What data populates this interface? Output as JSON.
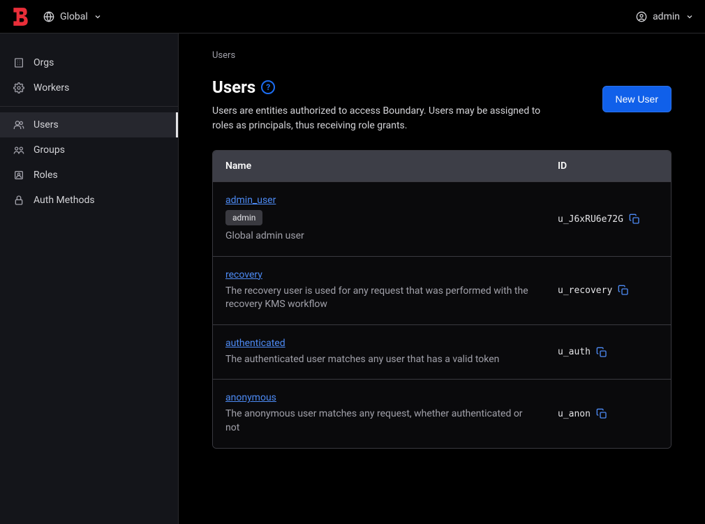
{
  "header": {
    "scope_label": "Global",
    "user_label": "admin"
  },
  "sidebar": {
    "group1": [
      {
        "label": "Orgs"
      },
      {
        "label": "Workers"
      }
    ],
    "group2": [
      {
        "label": "Users"
      },
      {
        "label": "Groups"
      },
      {
        "label": "Roles"
      },
      {
        "label": "Auth Methods"
      }
    ]
  },
  "breadcrumb": "Users",
  "page": {
    "title": "Users",
    "help_glyph": "?",
    "description": "Users are entities authorized to access Boundary. Users may be assigned to roles as principals, thus receiving role grants.",
    "new_button": "New User"
  },
  "table": {
    "headers": {
      "name": "Name",
      "id": "ID"
    },
    "rows": [
      {
        "name": "admin_user",
        "badge": "admin",
        "description": "Global admin user",
        "id": "u_J6xRU6e72G"
      },
      {
        "name": "recovery",
        "badge": null,
        "description": "The recovery user is used for any request that was performed with the recovery KMS workflow",
        "id": "u_recovery"
      },
      {
        "name": "authenticated",
        "badge": null,
        "description": "The authenticated user matches any user that has a valid token",
        "id": "u_auth"
      },
      {
        "name": "anonymous",
        "badge": null,
        "description": "The anonymous user matches any request, whether authenticated or not",
        "id": "u_anon"
      }
    ]
  }
}
